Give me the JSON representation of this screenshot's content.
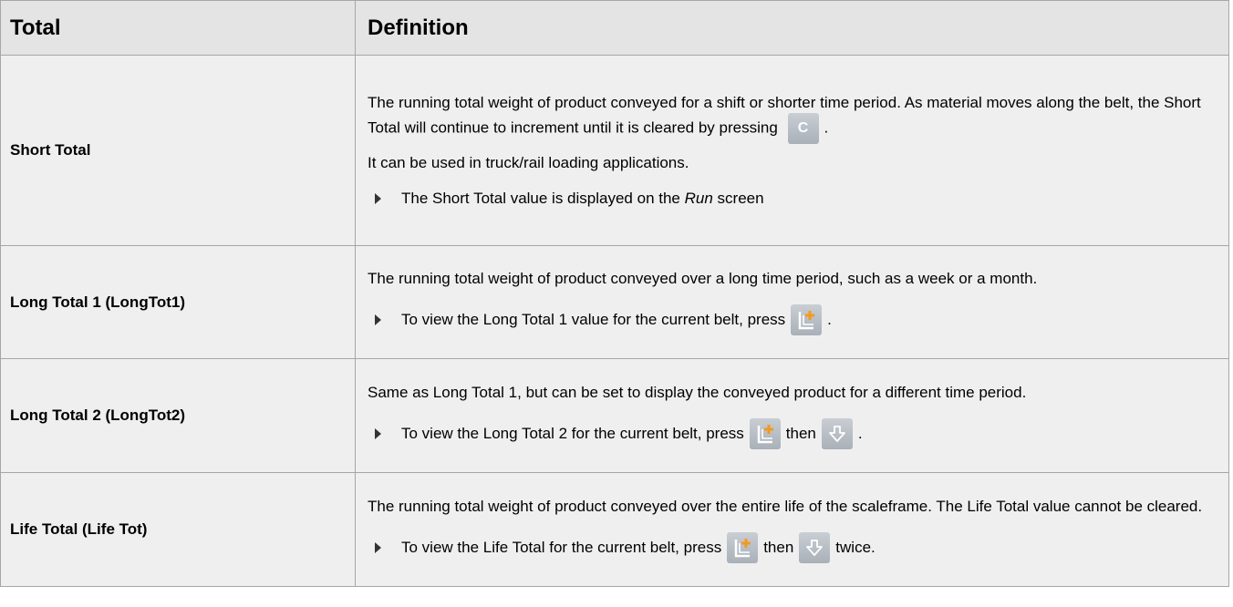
{
  "header": {
    "col1": "Total",
    "col2": "Definition"
  },
  "rows": [
    {
      "term": "Short Total",
      "p1_before_key": "The running total weight of product conveyed for a shift or shorter time period. As material moves along the belt, the Short Total will continue to increment until it is cleared by pressing",
      "key_label": "C",
      "p1_after_key": ".",
      "p2": "It can be used in truck/rail loading applications.",
      "bullet_before": "The Short Total value is displayed on the",
      "bullet_italic": "Run",
      "bullet_after": "screen"
    },
    {
      "term": "Long Total 1 (LongTot1)",
      "p1": "The running total weight of product conveyed over a long time period, such as a week or a month.",
      "bullet_before": "To view the Long Total 1 value for the current belt, press",
      "bullet_after": "."
    },
    {
      "term": "Long Total 2 (LongTot2)",
      "p1": "Same as Long Total 1, but can be set to display the conveyed product for a different time period.",
      "bullet_before": "To view the Long Total 2 for the current belt, press",
      "bullet_mid": "then",
      "bullet_after": "."
    },
    {
      "term": "Life Total (Life Tot)",
      "p1": "The running total weight of product conveyed over the entire life of the scaleframe. The Life Total value cannot be cleared.",
      "bullet_before": "To view the Life Total for the current belt, press",
      "bullet_mid": "then",
      "bullet_after": "twice."
    }
  ],
  "icons": {
    "clear_key": "clear-key-icon",
    "long_total_key": "long-total-key-icon",
    "down_arrow_key": "down-arrow-key-icon"
  },
  "colors": {
    "header_bg": "#e4e4e4",
    "row_bg": "#efefef",
    "border": "#a6a6a6",
    "key_accent": "#f29a1f"
  }
}
